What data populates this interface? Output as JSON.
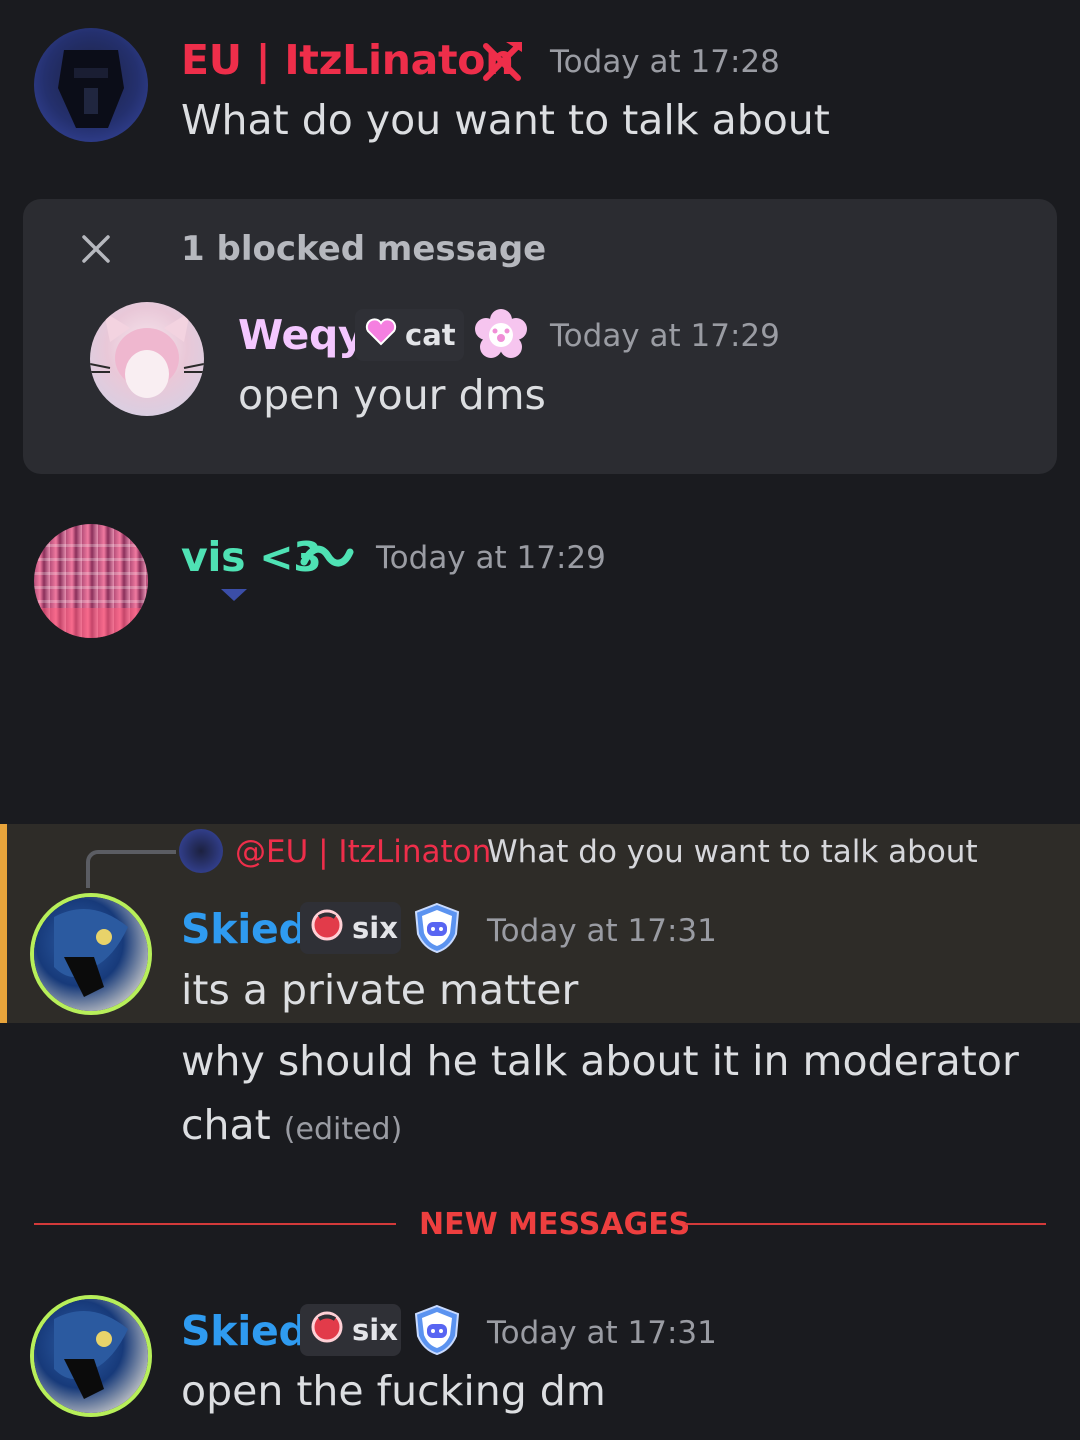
{
  "messages": {
    "linaton": {
      "username": "EU | ItzLinaton",
      "username_color": "#ee2e4a",
      "role_icon": "hammer-pickaxe-icon",
      "time": "Today at 17:28",
      "text": "What do you want to talk about"
    },
    "blocked": {
      "label": "1 blocked message",
      "close_icon": "close-icon",
      "weqy": {
        "username": "Weqy",
        "username_color": "#f4c7ff",
        "tag_text": "cat",
        "tag_icon": "pink-heart-icon",
        "badge_icon": "paw-flower-icon",
        "time": "Today at 17:29",
        "text": "open your dms"
      }
    },
    "vis": {
      "username": "vis <3",
      "username_color": "#4fe2b4",
      "badge_icon": "wave-icon",
      "time": "Today at 17:29"
    },
    "skied_reply": {
      "reply_to_username": "@EU | ItzLinaton",
      "reply_to_text": "What do you want to talk about",
      "username": "Skied",
      "username_color": "#2f9bf0",
      "tag_text": "six",
      "tag_icon": "red-orb-icon",
      "badge_icon": "discord-shield-icon",
      "time": "Today at 17:31",
      "text": "its a private matter",
      "followup_line1": "why should he talk about it in moderator",
      "followup_line2": "chat",
      "edited_label": "(edited)"
    },
    "divider": {
      "label": "NEW MESSAGES",
      "color": "#ee3f3f"
    },
    "skied_last": {
      "username": "Skied",
      "tag_text": "six",
      "time": "Today at 17:31",
      "text": "open the fucking dm"
    }
  }
}
